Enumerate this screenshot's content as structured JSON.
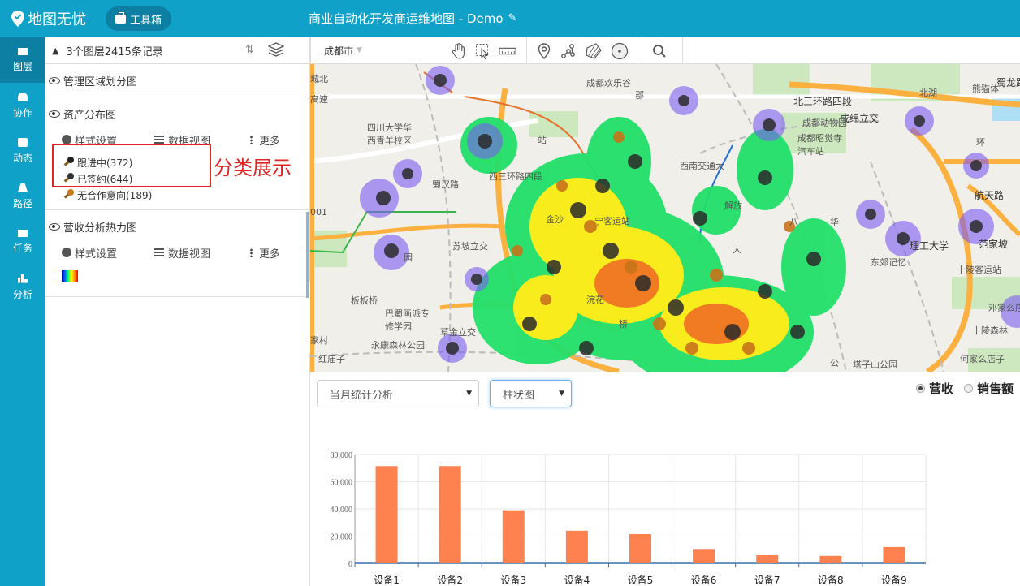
{
  "app": {
    "logo_text": "地图无忧",
    "toolbox_label": "工具箱",
    "map_title": "商业自动化开发商运维地图 - Demo"
  },
  "nav": [
    {
      "label": "图层",
      "icon": "layers-icon",
      "active": true
    },
    {
      "label": "协作",
      "icon": "user-icon"
    },
    {
      "label": "动态",
      "icon": "chat-icon"
    },
    {
      "label": "路径",
      "icon": "road-icon"
    },
    {
      "label": "任务",
      "icon": "task-icon"
    },
    {
      "label": "分析",
      "icon": "bar-chart-icon"
    }
  ],
  "panel": {
    "summary": "3个图层2415条记录",
    "layers": [
      {
        "title": "管理区域划分图"
      },
      {
        "title": "资产分布图",
        "style_label": "样式设置",
        "data_label": "数据视图",
        "more_label": "更多",
        "legend": [
          "跟进中(372)",
          "已签约(644)",
          "无合作意向(189)"
        ]
      },
      {
        "title": "营收分析热力图",
        "style_label": "样式设置",
        "data_label": "数据视图",
        "more_label": "更多"
      }
    ],
    "annotation": "分类展示"
  },
  "map_toolbar": {
    "city": "成都市"
  },
  "map": {
    "labels": [
      "成都欢乐谷",
      "北三环路四段",
      "成绵立交",
      "蜀龙路",
      "熊猫体",
      "北湖",
      "四川大学华西青羊校区",
      "成都动物园",
      "成都昭觉寺汽车站",
      "航天路",
      "西南交通大",
      "解放",
      "西三环路四段",
      "理工大学",
      "范家坡",
      "东郊记忆",
      "十陵客运站",
      "板板桥",
      "巴蜀画派专修学园",
      "浣花",
      "邓家么店",
      "草金立交",
      "永康森林公园",
      "十陵森林",
      "红庙子",
      "塔子山公园",
      "何家么店子",
      "苏坡立交",
      "金沙",
      "八",
      "高速",
      "城北",
      "蜀汉路",
      "华",
      "园",
      "公",
      "家村",
      "桥",
      "站",
      "郡",
      "大",
      "环",
      "001",
      "宁客运站"
    ]
  },
  "controls": {
    "period_select": "当月统计分析",
    "chart_type_select": "柱状图",
    "radio_revenue": "营收",
    "radio_sales": "销售额",
    "radio_selected": "营收"
  },
  "chart_data": {
    "type": "bar",
    "categories": [
      "设备1",
      "设备2",
      "设备3",
      "设备4",
      "设备5",
      "设备6",
      "设备7",
      "设备8",
      "设备9"
    ],
    "values": [
      71500,
      71500,
      39000,
      24000,
      21500,
      10000,
      6000,
      5500,
      12000
    ],
    "ylim": [
      0,
      80000
    ],
    "yticks": [
      "0",
      "20,000",
      "40,000",
      "60,000",
      "80,000"
    ],
    "bar_color": "#fd8250",
    "grid": true,
    "title": "",
    "xlabel": "",
    "ylabel": ""
  }
}
